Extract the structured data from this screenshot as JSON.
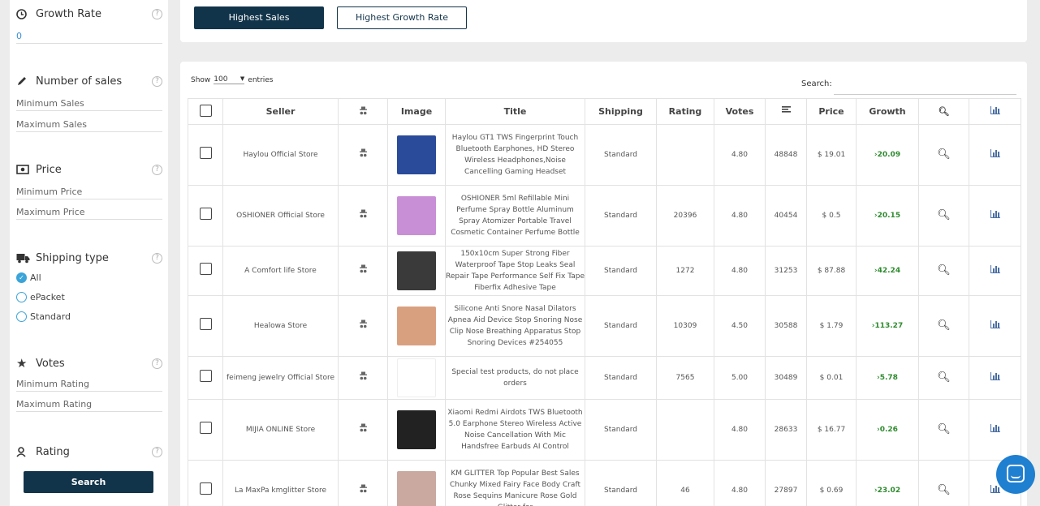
{
  "sidebar": {
    "growth": {
      "title": "Growth Rate",
      "value": "0"
    },
    "sales": {
      "title": "Number of sales",
      "min": "Minimum Sales",
      "max": "Maximum Sales"
    },
    "price": {
      "title": "Price",
      "min": "Minimum Price",
      "max": "Maximum Price"
    },
    "shipping": {
      "title": "Shipping type",
      "options": [
        "All",
        "ePacket",
        "Standard"
      ]
    },
    "votes": {
      "title": "Votes",
      "min": "Minimum Rating",
      "max": "Maximum Rating"
    },
    "rating": {
      "title": "Rating"
    },
    "search_label": "Search",
    "help": "?"
  },
  "top_buttons": {
    "highest_sales": "Highest Sales",
    "highest_growth": "Highest Growth Rate"
  },
  "table_controls": {
    "show": "Show",
    "entries": "entries",
    "page_size": "100",
    "search": "Search:"
  },
  "columns": [
    "Seller",
    "Image",
    "Title",
    "Shipping",
    "Rating",
    "Votes",
    "Price",
    "Growth"
  ],
  "rows": [
    {
      "seller": "Haylou Official Store",
      "title": "Haylou GT1 TWS Fingerprint Touch Bluetooth Earphones, HD Stereo Wireless Headphones,Noise Cancelling Gaming Headset",
      "shipping": "Standard",
      "rating": "",
      "votes": "4.80",
      "sales": "48848",
      "price": "$ 19.01",
      "growth": "›20.09",
      "img": "#2a4a9a"
    },
    {
      "seller": "OSHIONER Official Store",
      "title": "OSHIONER 5ml Refillable Mini Perfume Spray Bottle Aluminum Spray Atomizer Portable Travel Cosmetic Container Perfume Bottle",
      "shipping": "Standard",
      "rating": "20396",
      "votes": "4.80",
      "sales": "40454",
      "price": "$ 0.5",
      "growth": "›20.15",
      "img": "#c98fd6"
    },
    {
      "seller": "A Comfort life Store",
      "title": "150x10cm Super Strong Fiber Waterproof Tape Stop Leaks Seal Repair Tape Performance Self Fix Tape Fiberfix Adhesive Tape",
      "shipping": "Standard",
      "rating": "1272",
      "votes": "4.80",
      "sales": "31253",
      "price": "$ 87.88",
      "growth": "›42.24",
      "img": "#3a3a3a"
    },
    {
      "seller": "Healowa Store",
      "title": "Silicone Anti Snore Nasal Dilators Apnea Aid Device Stop Snoring Nose Clip Nose Breathing Apparatus Stop Snoring Devices #254055",
      "shipping": "Standard",
      "rating": "10309",
      "votes": "4.50",
      "sales": "30588",
      "price": "$ 1.79",
      "growth": "›113.27",
      "img": "#d9a080"
    },
    {
      "seller": "feimeng jewelry Official Store",
      "title": "Special test products, do not place orders",
      "shipping": "Standard",
      "rating": "7565",
      "votes": "5.00",
      "sales": "30489",
      "price": "$ 0.01",
      "growth": "›5.78",
      "img": "#ffffff"
    },
    {
      "seller": "MIJIA ONLINE Store",
      "title": "Xiaomi Redmi Airdots TWS Bluetooth 5.0 Earphone Stereo Wireless Active Noise Cancellation With Mic Handsfree Earbuds AI Control",
      "shipping": "Standard",
      "rating": "",
      "votes": "4.80",
      "sales": "28633",
      "price": "$ 16.77",
      "growth": "›0.26",
      "img": "#222222"
    },
    {
      "seller": "La MaxPa kmglitter Store",
      "title": "KM GLITTER Top Popular Best Sales Chunky Mixed Fairy Face Body Craft Rose Sequins Manicure Rose Gold Glitter for",
      "shipping": "Standard",
      "rating": "46",
      "votes": "4.80",
      "sales": "27897",
      "price": "$ 0.69",
      "growth": "›23.02",
      "img": "#c9a9a0"
    }
  ]
}
